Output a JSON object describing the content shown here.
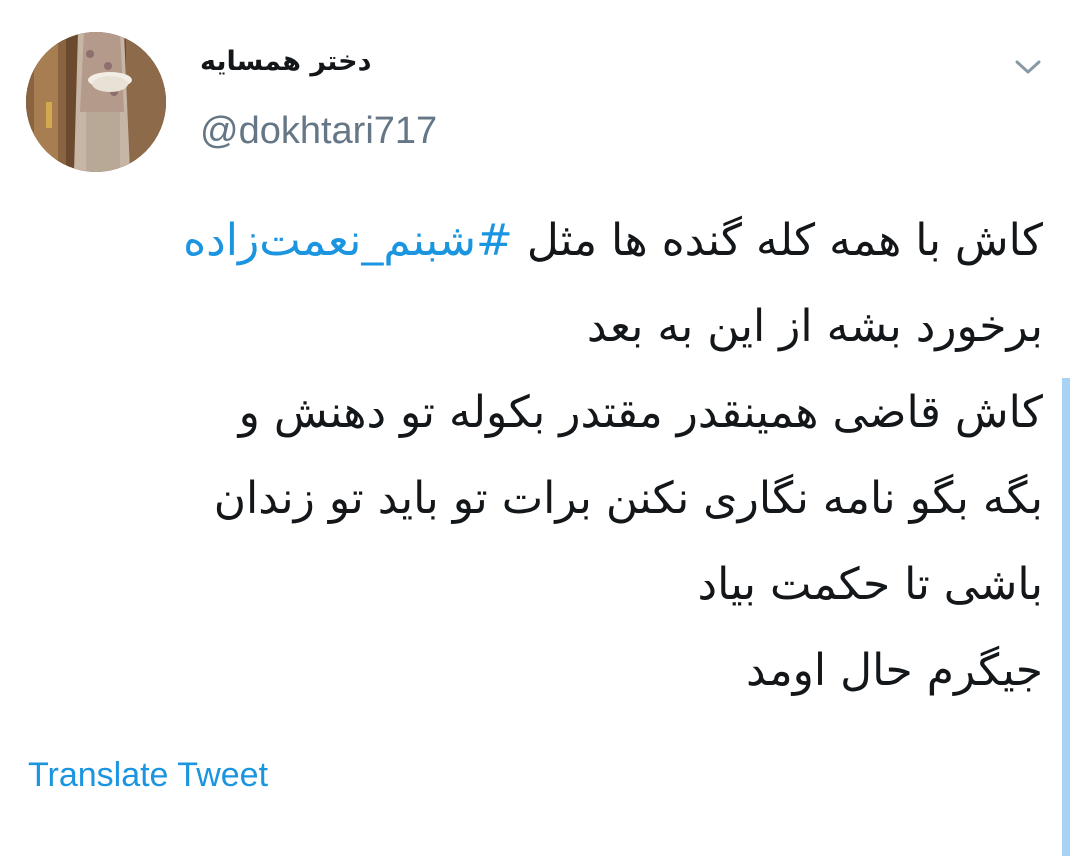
{
  "tweet": {
    "display_name": "دختر همسایه",
    "handle": "@dokhtari717",
    "body": {
      "line1_text": "کاش با همه کله گنده ها مثل ",
      "line1_hashtag": "#شبنم_نعمت‌زاده",
      "line2": "برخورد بشه از این به بعد",
      "line3": "کاش قاضی همینقدر مقتدر بکوله تو دهنش و",
      "line4": "بگه بگو نامه نگاری نکنن برات تو باید تو زندان",
      "line5": "باشی تا حکمت بیاد",
      "line6": "جیگرم حال اومد"
    },
    "translate_label": "Translate Tweet",
    "menu_icon": "chevron-down-icon"
  },
  "colors": {
    "accent": "#1b95e0",
    "text": "#14171a",
    "muted": "#657786",
    "scroll_indicator": "#a7d4f6"
  }
}
